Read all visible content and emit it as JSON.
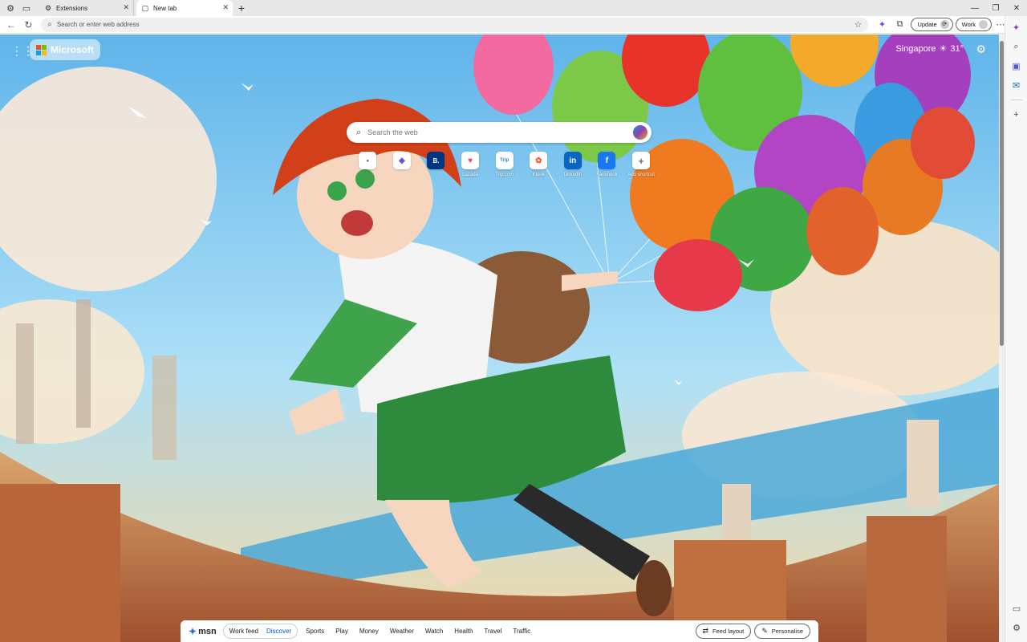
{
  "tabs": [
    {
      "label": "Extensions",
      "icon": "extensions-icon"
    },
    {
      "label": "New tab",
      "icon": "page-icon",
      "active": true
    }
  ],
  "address_bar": {
    "placeholder": "Search or enter web address"
  },
  "toolbar": {
    "update_label": "Update",
    "profile_label": "Work"
  },
  "newtab": {
    "brand": "Microsoft",
    "weather_location": "Singapore",
    "weather_temp": "31°",
    "search_placeholder": "Search the web",
    "shortcuts": [
      {
        "label": "",
        "tile": "•"
      },
      {
        "label": "",
        "tile": "◈"
      },
      {
        "label": "",
        "tile": "B."
      },
      {
        "label": "Lazada",
        "tile": "♥"
      },
      {
        "label": "Trip.com",
        "tile": "Trip"
      },
      {
        "label": "Klook",
        "tile": "✿"
      },
      {
        "label": "LinkedIn",
        "tile": "in"
      },
      {
        "label": "Facebook",
        "tile": "f"
      },
      {
        "label": "Add shortcut",
        "tile": "+"
      }
    ]
  },
  "feed": {
    "brand": "msn",
    "tabs": [
      "Work feed",
      "Discover"
    ],
    "active_tab": "Discover",
    "links": [
      "Sports",
      "Play",
      "Money",
      "Weather",
      "Watch",
      "Health",
      "Travel",
      "Traffic"
    ],
    "feed_layout_label": "Feed layout",
    "personalise_label": "Personalise"
  },
  "colors": {
    "accent": "#0b57d0",
    "sky": "#7ec8ee",
    "skirt": "#2e8b3d",
    "hair": "#d2401a"
  }
}
